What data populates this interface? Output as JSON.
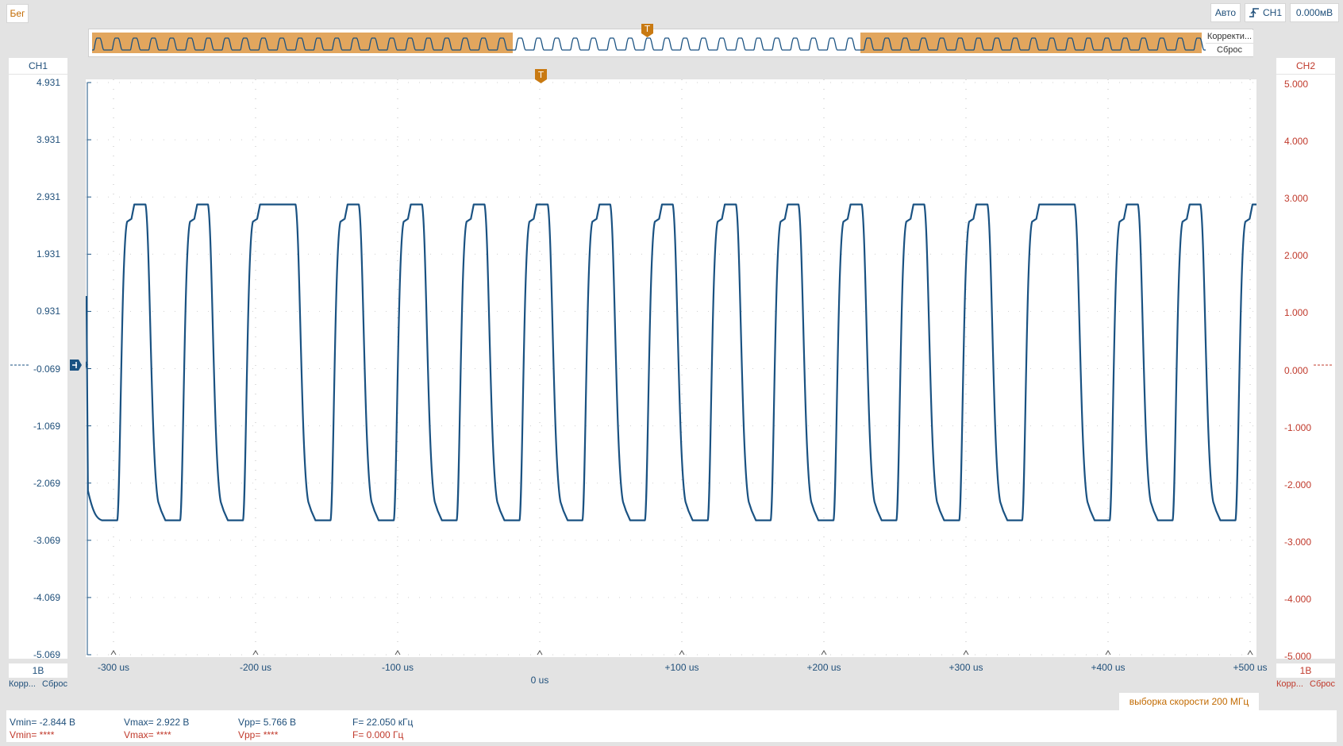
{
  "toolbar": {
    "run_label": "Бег",
    "auto_label": "Авто",
    "trigger_channel_label": "CH1",
    "trigger_level_label": "0.000мВ"
  },
  "overview": {
    "correct_label": "Корректи...",
    "reset_label": "Сброс",
    "highlight_color": "#e2a65e"
  },
  "channels": {
    "ch1": {
      "label": "CH1",
      "color": "#1a5282",
      "scale": "1В",
      "corr_label": "Корр...",
      "reset_label": "Сброс"
    },
    "ch2": {
      "label": "CH2",
      "color": "#c0392b",
      "scale": "1В",
      "corr_label": "Корр...",
      "reset_label": "Сброс"
    }
  },
  "axes": {
    "left_ticks": [
      "4.931",
      "3.931",
      "2.931",
      "1.931",
      "0.931",
      "-0.069",
      "-1.069",
      "-2.069",
      "-3.069",
      "-4.069",
      "-5.069"
    ],
    "right_ticks": [
      "5.000",
      "4.000",
      "3.000",
      "2.000",
      "1.000",
      "0.000",
      "-1.000",
      "-2.000",
      "-3.000",
      "-4.000",
      "-5.000"
    ],
    "x_ticks": [
      "-300 us",
      "-200 us",
      "-100 us",
      "",
      "+100 us",
      "+200 us",
      "+300 us",
      "+400 us",
      "+500 us"
    ],
    "x_zero_label": "0 us"
  },
  "trigger_marker": "T",
  "sample_rate_label": "выборка скорости 200 МГц",
  "measurements": {
    "ch1": {
      "vmin": "Vmin= -2.844 В",
      "vmax": "Vmax= 2.922 В",
      "vpp": "Vpp= 5.766 В",
      "freq": "F= 22.050 кГц"
    },
    "ch2": {
      "vmin": "Vmin= ****",
      "vmax": "Vmax= ****",
      "vpp": "Vpp= ****",
      "freq": "F= 0.000 Гц"
    }
  },
  "chart_data": {
    "type": "line",
    "xlabel": "",
    "ylabel": "",
    "xlim": [
      -320,
      502
    ],
    "ylim": [
      -5.069,
      4.931
    ],
    "grid": true,
    "series": [
      {
        "name": "CH1",
        "waveform": "rounded square",
        "periods_us": [
          46,
          45,
          46,
          46,
          46,
          45,
          46,
          45,
          45,
          46,
          45,
          46,
          45,
          46,
          45,
          46,
          45,
          46,
          45
        ],
        "high_v": 2.8,
        "low_v": -2.6
      }
    ]
  }
}
